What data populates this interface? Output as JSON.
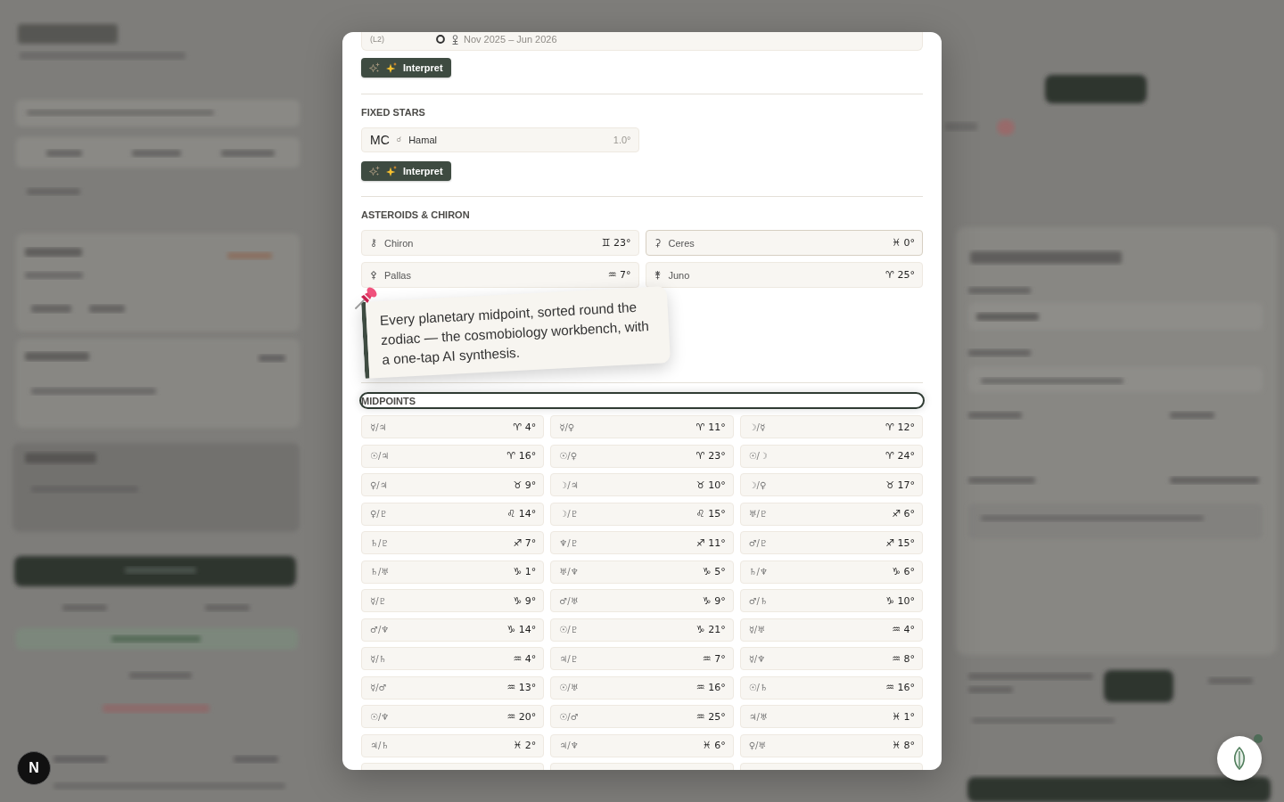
{
  "progression": {
    "tag": "(L2)",
    "period": "Nov 2025 – Jun 2026",
    "button": "Interpret"
  },
  "sections": [
    {
      "kind": "fixed_stars",
      "title": "FIXED STARS",
      "highlighted": false,
      "items": [
        {
          "point": "MC",
          "aspect": "☌",
          "name": "Hamal",
          "orb": "1.0°"
        }
      ],
      "button": "Interpret"
    },
    {
      "kind": "asteroids",
      "title": "ASTEROIDS & CHIRON",
      "highlighted": false,
      "items": [
        {
          "glyph": "⚷",
          "name": "Chiron",
          "position": "♊ 23°",
          "selected": false
        },
        {
          "glyph": "⚳",
          "name": "Ceres",
          "position": "♓ 0°",
          "selected": true
        },
        {
          "glyph": "⚴",
          "name": "Pallas",
          "position": "♒ 7°",
          "selected": false
        },
        {
          "glyph": "⚵",
          "name": "Juno",
          "position": "♈ 25°",
          "selected": false
        }
      ]
    },
    {
      "kind": "midpoints",
      "title": "MIDPOINTS",
      "highlighted": true,
      "items": [
        {
          "pair": "☿/♃",
          "position": "♈ 4°"
        },
        {
          "pair": "☿/♀",
          "position": "♈ 11°"
        },
        {
          "pair": "☽/☿",
          "position": "♈ 12°"
        },
        {
          "pair": "☉/♃",
          "position": "♈ 16°"
        },
        {
          "pair": "☉/♀",
          "position": "♈ 23°"
        },
        {
          "pair": "☉/☽",
          "position": "♈ 24°"
        },
        {
          "pair": "♀/♃",
          "position": "♉ 9°"
        },
        {
          "pair": "☽/♃",
          "position": "♉ 10°"
        },
        {
          "pair": "☽/♀",
          "position": "♉ 17°"
        },
        {
          "pair": "♀/♇",
          "position": "♌ 14°"
        },
        {
          "pair": "☽/♇",
          "position": "♌ 15°"
        },
        {
          "pair": "♅/♇",
          "position": "♐ 6°"
        },
        {
          "pair": "♄/♇",
          "position": "♐ 7°"
        },
        {
          "pair": "♆/♇",
          "position": "♐ 11°"
        },
        {
          "pair": "♂/♇",
          "position": "♐ 15°"
        },
        {
          "pair": "♄/♅",
          "position": "♑ 1°"
        },
        {
          "pair": "♅/♆",
          "position": "♑ 5°"
        },
        {
          "pair": "♄/♆",
          "position": "♑ 6°"
        },
        {
          "pair": "☿/♇",
          "position": "♑ 9°"
        },
        {
          "pair": "♂/♅",
          "position": "♑ 9°"
        },
        {
          "pair": "♂/♄",
          "position": "♑ 10°"
        },
        {
          "pair": "♂/♆",
          "position": "♑ 14°"
        },
        {
          "pair": "☉/♇",
          "position": "♑ 21°"
        },
        {
          "pair": "☿/♅",
          "position": "♒ 4°"
        },
        {
          "pair": "☿/♄",
          "position": "♒ 4°"
        },
        {
          "pair": "♃/♇",
          "position": "♒ 7°"
        },
        {
          "pair": "☿/♆",
          "position": "♒ 8°"
        },
        {
          "pair": "☿/♂",
          "position": "♒ 13°"
        },
        {
          "pair": "☉/♅",
          "position": "♒ 16°"
        },
        {
          "pair": "☉/♄",
          "position": "♒ 16°"
        },
        {
          "pair": "☉/♆",
          "position": "♒ 20°"
        },
        {
          "pair": "☉/♂",
          "position": "♒ 25°"
        },
        {
          "pair": "♃/♅",
          "position": "♓ 1°"
        },
        {
          "pair": "♃/♄",
          "position": "♓ 2°"
        },
        {
          "pair": "♃/♆",
          "position": "♓ 6°"
        },
        {
          "pair": "♀/♅",
          "position": "♓ 8°"
        }
      ]
    }
  ],
  "callout": {
    "text": "Every planetary midpoint, sorted round the zodiac — the cosmobiology workbench, with a one-tap AI synthesis."
  },
  "dev_indicator": {
    "label": "N"
  }
}
